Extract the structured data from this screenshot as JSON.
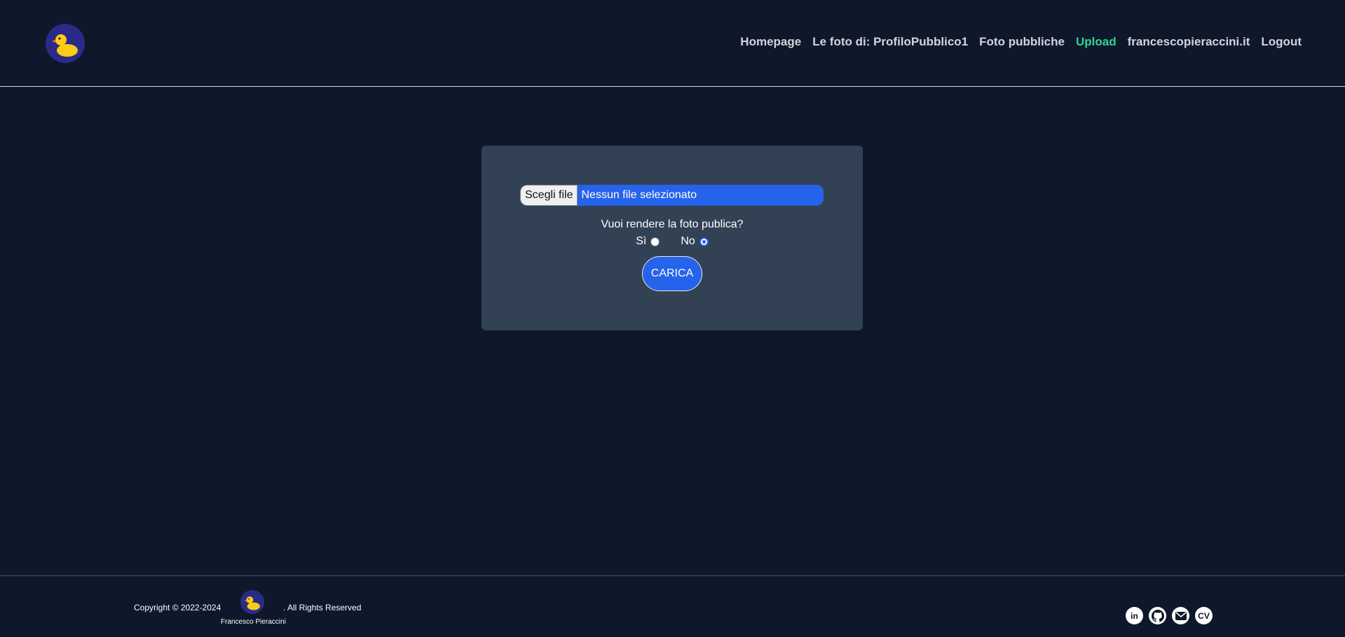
{
  "nav": {
    "items": [
      {
        "label": "Homepage",
        "active": false
      },
      {
        "label": "Le foto di: ProfiloPubblico1",
        "active": false
      },
      {
        "label": "Foto pubbliche",
        "active": false
      },
      {
        "label": "Upload",
        "active": true
      },
      {
        "label": "francescopieraccini.it",
        "active": false
      },
      {
        "label": "Logout",
        "active": false
      }
    ]
  },
  "upload": {
    "choose_file_label": "Scegli file",
    "file_status": "Nessun file selezionato",
    "question": "Vuoi rendere la foto publica?",
    "option_yes": "Sì",
    "option_no": "No",
    "selected": "No",
    "submit_label": "CARICA"
  },
  "footer": {
    "copyright": "Copyright © 2022-2024",
    "logo_name": "Francesco Pieraccini",
    "rights": ". All Rights Reserved",
    "social": [
      {
        "icon": "linkedin-icon",
        "glyph": "in"
      },
      {
        "icon": "github-icon",
        "glyph": ""
      },
      {
        "icon": "mail-icon",
        "glyph": ""
      },
      {
        "icon": "cv-icon",
        "glyph": "CV"
      }
    ]
  },
  "colors": {
    "background": "#0f172a",
    "card": "#334155",
    "accent": "#2563eb",
    "active_nav": "#34d399",
    "logo": "#2b2a8a",
    "duck": "#facc15"
  }
}
